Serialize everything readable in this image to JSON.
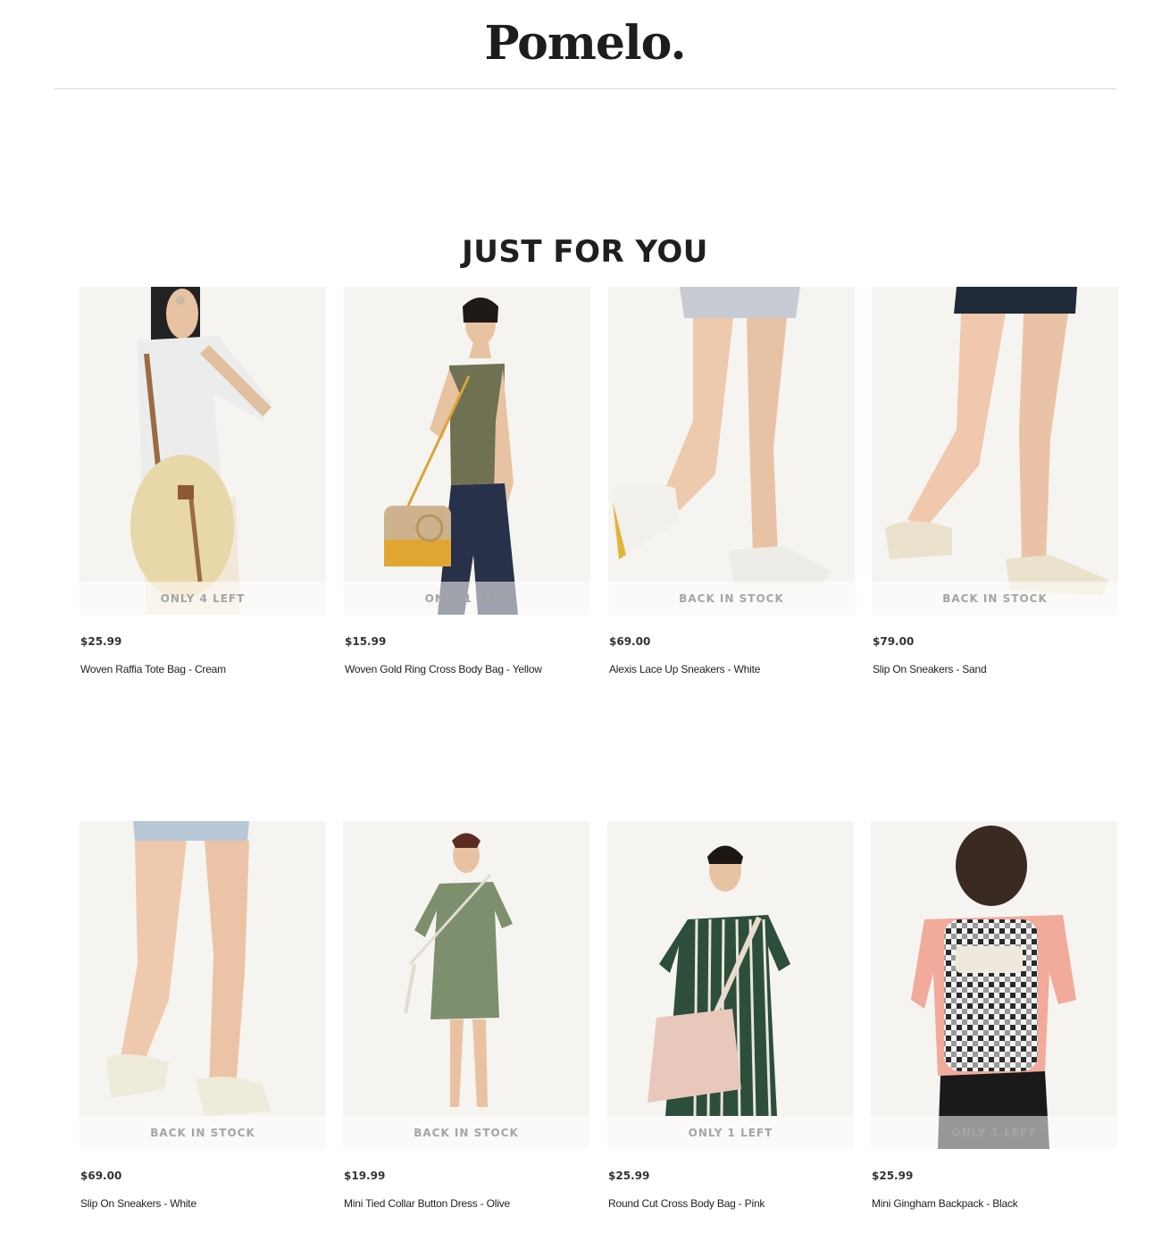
{
  "header": {
    "logo": "Pomelo."
  },
  "section": {
    "title": "JUST FOR YOU"
  },
  "products": [
    {
      "badge": "ONLY 4 LEFT",
      "price": "$25.99",
      "name": "Woven Raffia Tote Bag - Cream"
    },
    {
      "badge": "ONLY 1 LEFT",
      "price": "$15.99",
      "name": "Woven Gold Ring Cross Body Bag - Yellow"
    },
    {
      "badge": "BACK IN STOCK",
      "price": "$69.00",
      "name": "Alexis Lace Up Sneakers - White"
    },
    {
      "badge": "BACK IN STOCK",
      "price": "$79.00",
      "name": "Slip On Sneakers - Sand"
    },
    {
      "badge": "BACK IN STOCK",
      "price": "$69.00",
      "name": "Slip On Sneakers - White"
    },
    {
      "badge": "BACK IN STOCK",
      "price": "$19.99",
      "name": "Mini Tied Collar Button Dress - Olive"
    },
    {
      "badge": "ONLY 1 LEFT",
      "price": "$25.99",
      "name": "Round Cut Cross Body Bag - Pink"
    },
    {
      "badge": "ONLY 1 LEFT",
      "price": "$25.99",
      "name": "Mini Gingham Backpack - Black"
    }
  ]
}
